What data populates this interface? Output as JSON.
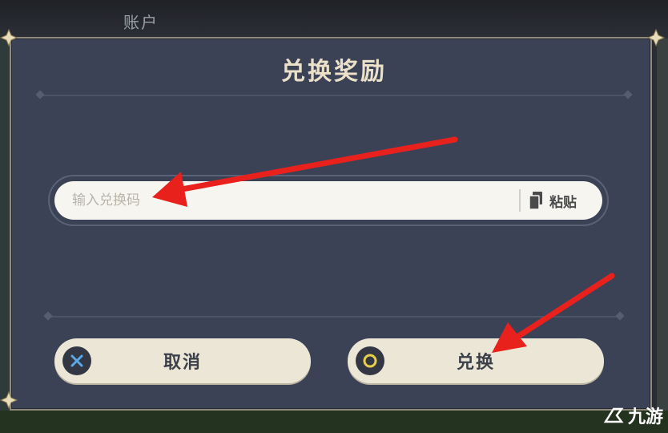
{
  "header": {
    "account_tab": "账户"
  },
  "dialog": {
    "title": "兑换奖励",
    "code_input": {
      "placeholder": "输入兑换码",
      "value": ""
    },
    "paste_button": {
      "label": "粘贴",
      "icon": "clipboard-icon"
    },
    "cancel_button": {
      "label": "取消",
      "icon": "x-button-icon"
    },
    "redeem_button": {
      "label": "兑换",
      "icon": "o-button-icon"
    }
  },
  "watermark": {
    "logo_text": "九游"
  },
  "colors": {
    "panel": "#3b4256",
    "title": "#ebe1c8",
    "button_bg": "#ece6d6",
    "annotation_arrow": "#e8211d"
  }
}
